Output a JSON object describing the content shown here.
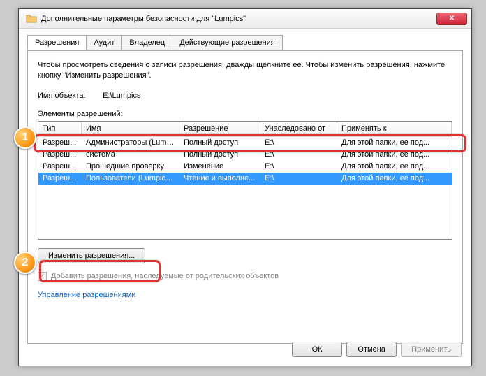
{
  "window": {
    "title": "Дополнительные параметры безопасности  для \"Lumpics\""
  },
  "tabs": {
    "t0": "Разрешения",
    "t1": "Аудит",
    "t2": "Владелец",
    "t3": "Действующие разрешения"
  },
  "panel": {
    "desc": "Чтобы просмотреть сведения о записи разрешения, дважды щелкните ее. Чтобы изменить разрешения, нажмите кнопку \"Изменить разрешения\".",
    "objLabel": "Имя объекта:",
    "objValue": "E:\\Lumpics",
    "listLabel": "Элементы разрешений:",
    "cols": {
      "c0": "Тип",
      "c1": "Имя",
      "c2": "Разрешение",
      "c3": "Унаследовано от",
      "c4": "Применять к"
    },
    "rows": [
      {
        "c0": "Разреш...",
        "c1": "Администраторы (Lumpi...",
        "c2": "Полный доступ",
        "c3": "E:\\",
        "c4": "Для этой папки, ее под..."
      },
      {
        "c0": "Разреш...",
        "c1": "система",
        "c2": "Полный доступ",
        "c3": "E:\\",
        "c4": "Для этой папки, ее под..."
      },
      {
        "c0": "Разреш...",
        "c1": "Прошедшие проверку",
        "c2": "Изменение",
        "c3": "E:\\",
        "c4": "Для этой папки, ее под..."
      },
      {
        "c0": "Разреш...",
        "c1": "Пользователи (Lumpics-...",
        "c2": "Чтение и выполне...",
        "c3": "E:\\",
        "c4": "Для этой папки, ее под..."
      }
    ],
    "editBtn": "Изменить разрешения...",
    "inheritChk": "Добавить разрешения, наследуемые от родительских объектов",
    "manageLink": "Управление разрешениями"
  },
  "footer": {
    "ok": "ОК",
    "cancel": "Отмена",
    "apply": "Применить"
  },
  "markers": {
    "m1": "1",
    "m2": "2"
  }
}
